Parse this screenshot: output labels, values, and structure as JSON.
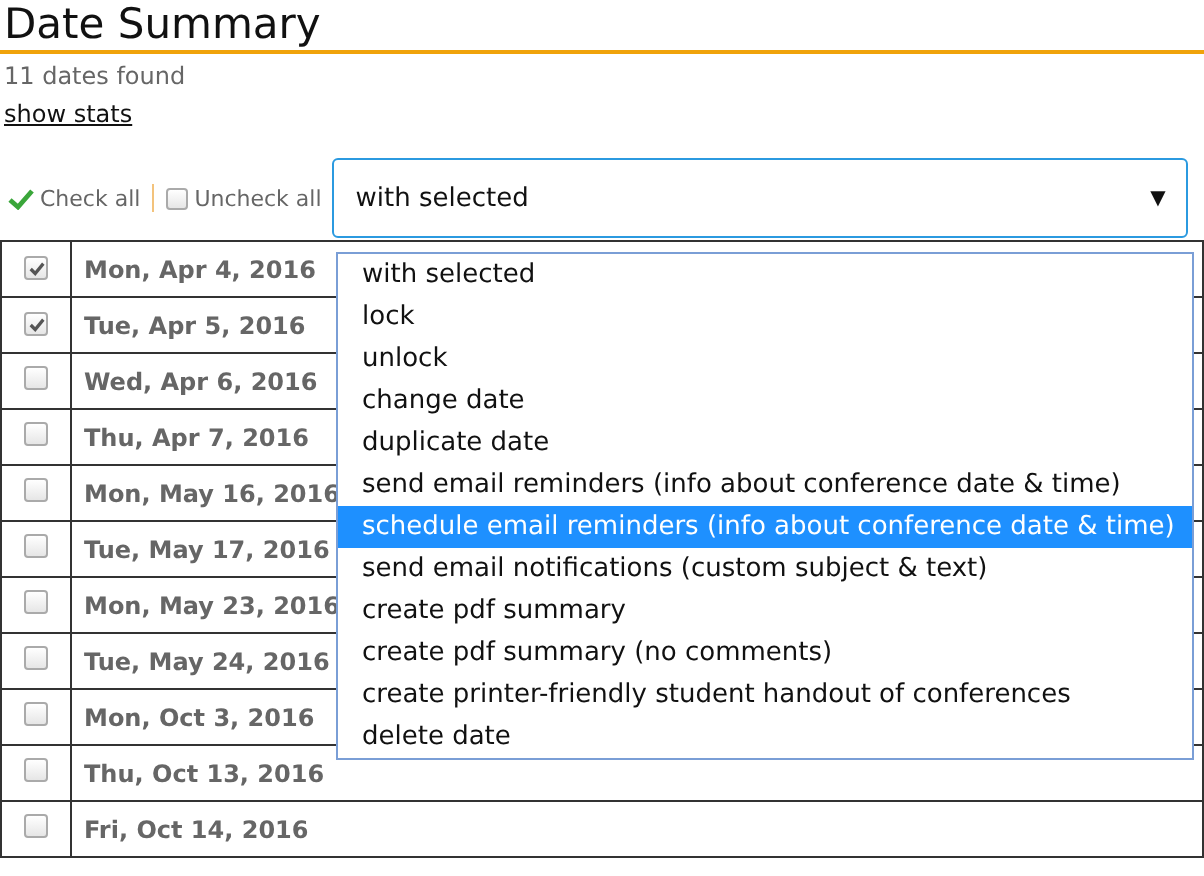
{
  "title": "Date Summary",
  "count_text": "11 dates found",
  "stats_link": "show stats",
  "toolbar": {
    "check_all": "Check all",
    "uncheck_all": "Uncheck all",
    "select_value": "with selected",
    "arrow": "▼"
  },
  "menu": [
    {
      "label": "with selected",
      "selected": false
    },
    {
      "label": "lock",
      "selected": false
    },
    {
      "label": "unlock",
      "selected": false
    },
    {
      "label": "change date",
      "selected": false
    },
    {
      "label": "duplicate date",
      "selected": false
    },
    {
      "label": "send email reminders (info about conference date & time)",
      "selected": false
    },
    {
      "label": "schedule email reminders (info about conference date & time)",
      "selected": true
    },
    {
      "label": "send email notifications (custom subject & text)",
      "selected": false
    },
    {
      "label": "create pdf summary",
      "selected": false
    },
    {
      "label": "create pdf summary (no comments)",
      "selected": false
    },
    {
      "label": "create printer-friendly student handout of conferences",
      "selected": false
    },
    {
      "label": "delete date",
      "selected": false
    }
  ],
  "rows": [
    {
      "date": "Mon, Apr 4, 2016",
      "checked": true
    },
    {
      "date": "Tue, Apr 5, 2016",
      "checked": true
    },
    {
      "date": "Wed, Apr 6, 2016",
      "checked": false
    },
    {
      "date": "Thu, Apr 7, 2016",
      "checked": false
    },
    {
      "date": "Mon, May 16, 2016",
      "checked": false
    },
    {
      "date": "Tue, May 17, 2016",
      "checked": false
    },
    {
      "date": "Mon, May 23, 2016",
      "checked": false
    },
    {
      "date": "Tue, May 24, 2016",
      "checked": false
    },
    {
      "date": "Mon, Oct 3, 2016",
      "checked": false
    },
    {
      "date": "Thu, Oct 13, 2016",
      "checked": false
    },
    {
      "date": "Fri, Oct 14, 2016",
      "checked": false
    }
  ]
}
